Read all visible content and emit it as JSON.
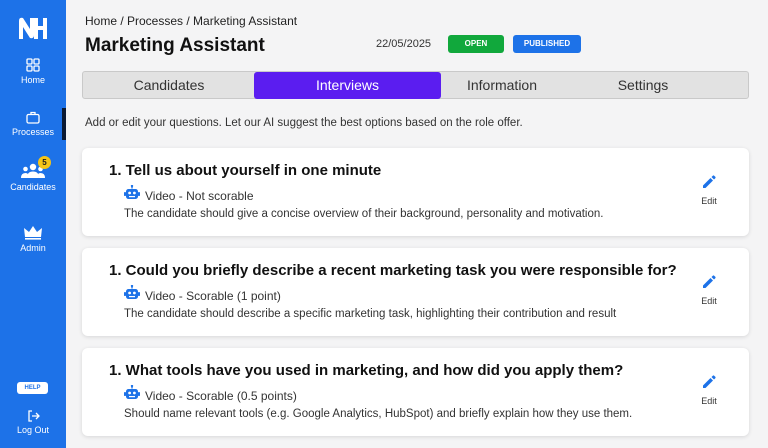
{
  "sidebar": {
    "logo": "NH",
    "items": [
      {
        "label": "Home",
        "icon": "grid-icon"
      },
      {
        "label": "Processes",
        "icon": "briefcase-icon"
      },
      {
        "label": "Candidates",
        "icon": "people-icon",
        "badge": "5"
      },
      {
        "label": "Admin",
        "icon": "crown-icon"
      }
    ],
    "help": "HELP",
    "logout": "Log Out"
  },
  "header": {
    "breadcrumb": "Home / Processes / Marketing Assistant",
    "title": "Marketing Assistant",
    "date": "22/05/2025",
    "status_open": "OPEN",
    "status_published": "PUBLISHED"
  },
  "tabs": [
    {
      "label": "Candidates"
    },
    {
      "label": "Interviews",
      "active": true
    },
    {
      "label": "Information"
    },
    {
      "label": "Settings"
    }
  ],
  "intro": "Add or edit your questions. Let our AI suggest the best options based  on the role offer.",
  "questions": [
    {
      "title": "1.  Tell us about yourself in one minute",
      "type": "Video - Not scorable",
      "description": "The candidate should give a concise overview of their background, personality and motivation.",
      "edit": "Edit"
    },
    {
      "title": "1.  Could you briefly describe a recent marketing task you were responsible for?",
      "type": "Video - Scorable (1 point)",
      "description": "The candidate should describe a specific marketing task, highlighting their contribution and result",
      "edit": "Edit"
    },
    {
      "title": "1.  What tools have you used in marketing, and how did you apply them?",
      "type": "Video - Scorable (0.5 points)",
      "description": "Should name relevant tools (e.g. Google Analytics, HubSpot) and briefly explain how they use them.",
      "edit": "Edit"
    }
  ],
  "colors": {
    "sidebar": "#1d72e8",
    "active_tab": "#5b1df0",
    "open": "#11a83c",
    "published": "#1d72e8"
  }
}
